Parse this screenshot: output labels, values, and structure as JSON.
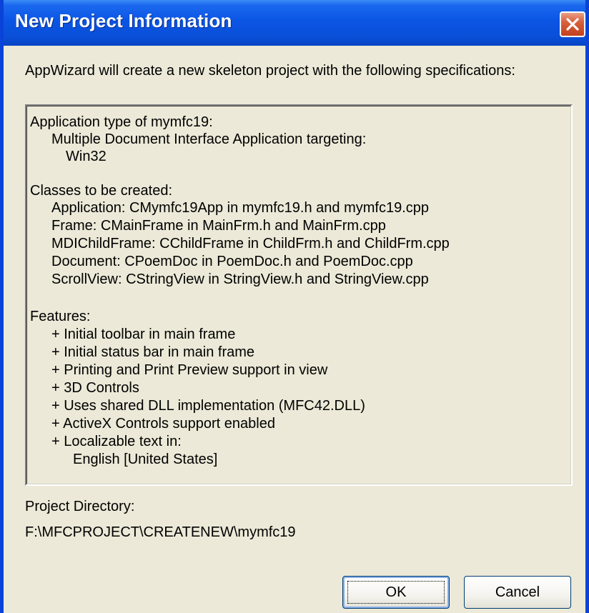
{
  "window": {
    "title": "New Project Information"
  },
  "dialog": {
    "intro": "AppWizard will create a new skeleton project with the following specifications:",
    "spec_lines": [
      "Application type of mymfc19:",
      "Multiple Document Interface Application targeting:",
      "Win32",
      "",
      "Classes to be created:",
      "Application: CMymfc19App in mymfc19.h and mymfc19.cpp",
      "Frame: CMainFrame in MainFrm.h and MainFrm.cpp",
      "MDIChildFrame: CChildFrame in ChildFrm.h and ChildFrm.cpp",
      "Document: CPoemDoc in PoemDoc.h and PoemDoc.cpp",
      "ScrollView: CStringView in StringView.h and StringView.cpp",
      "",
      "Features:",
      "+ Initial toolbar in main frame",
      "+ Initial status bar in main frame",
      "+ Printing and Print Preview support in view",
      "+ 3D Controls",
      "+ Uses shared DLL implementation (MFC42.DLL)",
      "+ ActiveX Controls support enabled",
      "+ Localizable text in:",
      "English [United States]"
    ],
    "project_directory_label": "Project Directory:",
    "project_directory_value": "F:\\MFCPROJECT\\CREATENEW\\mymfc19",
    "ok_label": "OK",
    "cancel_label": "Cancel"
  },
  "icons": {
    "close": "close-icon"
  },
  "colors": {
    "titlebar": "#0a4fd8",
    "dialog_bg": "#ece9d8",
    "close_button": "#d8603c"
  }
}
